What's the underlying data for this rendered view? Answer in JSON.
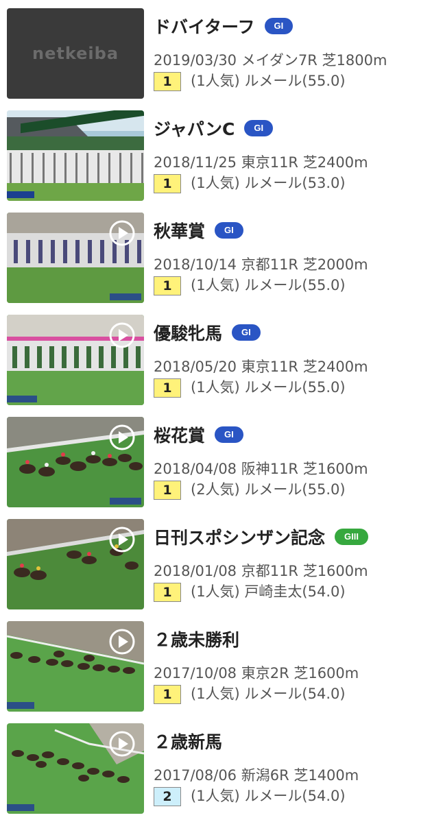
{
  "colors": {
    "g1": "#2a55c4",
    "g3": "#36a83e",
    "first": "#fff27a",
    "second": "#cdeffb"
  },
  "logo_text": "netkeiba",
  "races": [
    {
      "title": "ドバイターフ",
      "grade": "GI",
      "grade_color": "#2a55c4",
      "info": "2019/03/30 メイダン7R 芝1800m",
      "position": "1",
      "popularity": "(1人気)",
      "jockey": "ルメール(55.0)",
      "thumb": "logo",
      "play_icon": "none"
    },
    {
      "title": "ジャパンC",
      "grade": "GI",
      "grade_color": "#2a55c4",
      "info": "2018/11/25 東京11R 芝2400m",
      "position": "1",
      "popularity": "(1人気)",
      "jockey": "ルメール(53.0)",
      "thumb": "gate",
      "play_icon": "none"
    },
    {
      "title": "秋華賞",
      "grade": "GI",
      "grade_color": "#2a55c4",
      "info": "2018/10/14 京都11R 芝2000m",
      "position": "1",
      "popularity": "(1人気)",
      "jockey": "ルメール(55.0)",
      "thumb": "gate",
      "play_icon": "play-icon"
    },
    {
      "title": "優駿牝馬",
      "grade": "GI",
      "grade_color": "#2a55c4",
      "info": "2018/05/20 東京11R 芝2400m",
      "position": "1",
      "popularity": "(1人気)",
      "jockey": "ルメール(55.0)",
      "thumb": "gate",
      "play_icon": "play-icon"
    },
    {
      "title": "桜花賞",
      "grade": "GI",
      "grade_color": "#2a55c4",
      "info": "2018/04/08 阪神11R 芝1600m",
      "position": "1",
      "popularity": "(2人気)",
      "jockey": "ルメール(55.0)",
      "thumb": "race",
      "play_icon": "play-icon"
    },
    {
      "title": "日刊スポシンザン記念",
      "grade": "GIII",
      "grade_color": "#36a83e",
      "info": "2018/01/08 京都11R 芝1600m",
      "position": "1",
      "popularity": "(1人気)",
      "jockey": "戸崎圭太(54.0)",
      "thumb": "race",
      "play_icon": "play-icon"
    },
    {
      "title": "２歳未勝利",
      "grade": "",
      "grade_color": "",
      "info": "2017/10/08 東京2R 芝1600m",
      "position": "1",
      "popularity": "(1人気)",
      "jockey": "ルメール(54.0)",
      "thumb": "race",
      "play_icon": "play-icon"
    },
    {
      "title": "２歳新馬",
      "grade": "",
      "grade_color": "",
      "info": "2017/08/06 新潟6R 芝1400m",
      "position": "2",
      "popularity": "(1人気)",
      "jockey": "ルメール(54.0)",
      "thumb": "race",
      "play_icon": "play-icon"
    }
  ]
}
